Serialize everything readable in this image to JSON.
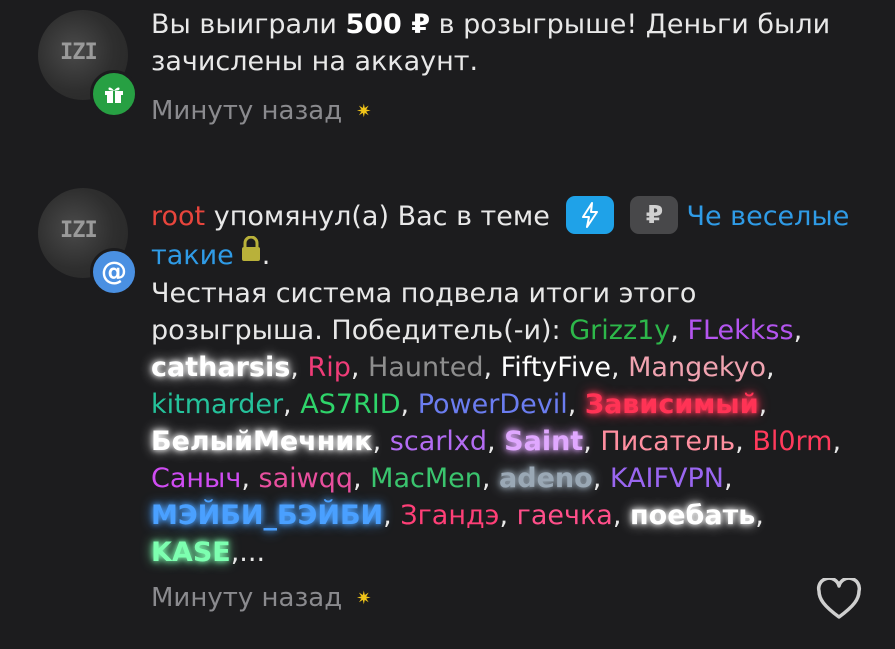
{
  "notifications": [
    {
      "avatar_logo": "IZI",
      "badge_icon": "gift-icon",
      "badge_color": "#27a043",
      "text_pre": "Вы выиграли ",
      "text_bold": "500 ₽",
      "text_post": " в розыгрыше! Деньги были зачислены на аккаунт.",
      "time": "Минуту назад"
    },
    {
      "avatar_logo": "IZI",
      "badge_icon": "at-icon",
      "badge_symbol": "@",
      "badge_color": "#4a90e2",
      "author": "root",
      "action": " упомянул(а) Вас в теме ",
      "prefix_icon_1": "bolt-icon",
      "prefix_icon_2": "ruble-icon",
      "prefix_rub": "₽",
      "thread_title": "Че веселые такие",
      "after_lock": ".",
      "body": "Честная система подвела итоги этого розыгрыша. Победитель(-и): ",
      "winners": [
        {
          "name": "Grizz1y",
          "color": "#2db84a"
        },
        {
          "name": "FLekkss",
          "color": "#b455ef"
        },
        {
          "name": "catharsis",
          "color": "#ffffff"
        },
        {
          "name": "Rip",
          "color": "#f03c78"
        },
        {
          "name": "Haunted",
          "color": "#8e8e8e"
        },
        {
          "name": "FiftyFive",
          "color": "#ffffff"
        },
        {
          "name": "Mangekyo",
          "color": "#f0a3b0"
        },
        {
          "name": "kitmarder",
          "color": "#25c29b"
        },
        {
          "name": "AS7RID",
          "color": "#2fd46a"
        },
        {
          "name": "PowerDevil",
          "color": "#6b7df0"
        },
        {
          "name": "Зависимый",
          "color": "#ff3355"
        },
        {
          "name": "БелыйМечник",
          "color": "#ffffff"
        },
        {
          "name": "scarlxd",
          "color": "#b36cf2"
        },
        {
          "name": "Saint",
          "color": "#e0a8ff"
        },
        {
          "name": "Писатель",
          "color": "#ff8fa0"
        },
        {
          "name": "Bl0rm",
          "color": "#ff3a5c"
        },
        {
          "name": "Саныч",
          "color": "#cf4cf2"
        },
        {
          "name": "saiwqq",
          "color": "#e84f9e"
        },
        {
          "name": "MacMen",
          "color": "#3ac46e"
        },
        {
          "name": "adeno",
          "color": "#9aa8b5"
        },
        {
          "name": "KAIFVPN",
          "color": "#9a66f0"
        },
        {
          "name": "МЭЙБИ_БЭЙБИ",
          "color": "#4aa0ff"
        },
        {
          "name": "Згандэ",
          "color": "#ff3f77"
        },
        {
          "name": "гаечка",
          "color": "#ff4f8a"
        },
        {
          "name": "поебать",
          "color": "#ffffff"
        },
        {
          "name": "KASE",
          "color": "#7dffb0"
        }
      ],
      "ellipsis": ",...",
      "time": "Минуту назад"
    }
  ],
  "heart_icon": "heart-icon"
}
